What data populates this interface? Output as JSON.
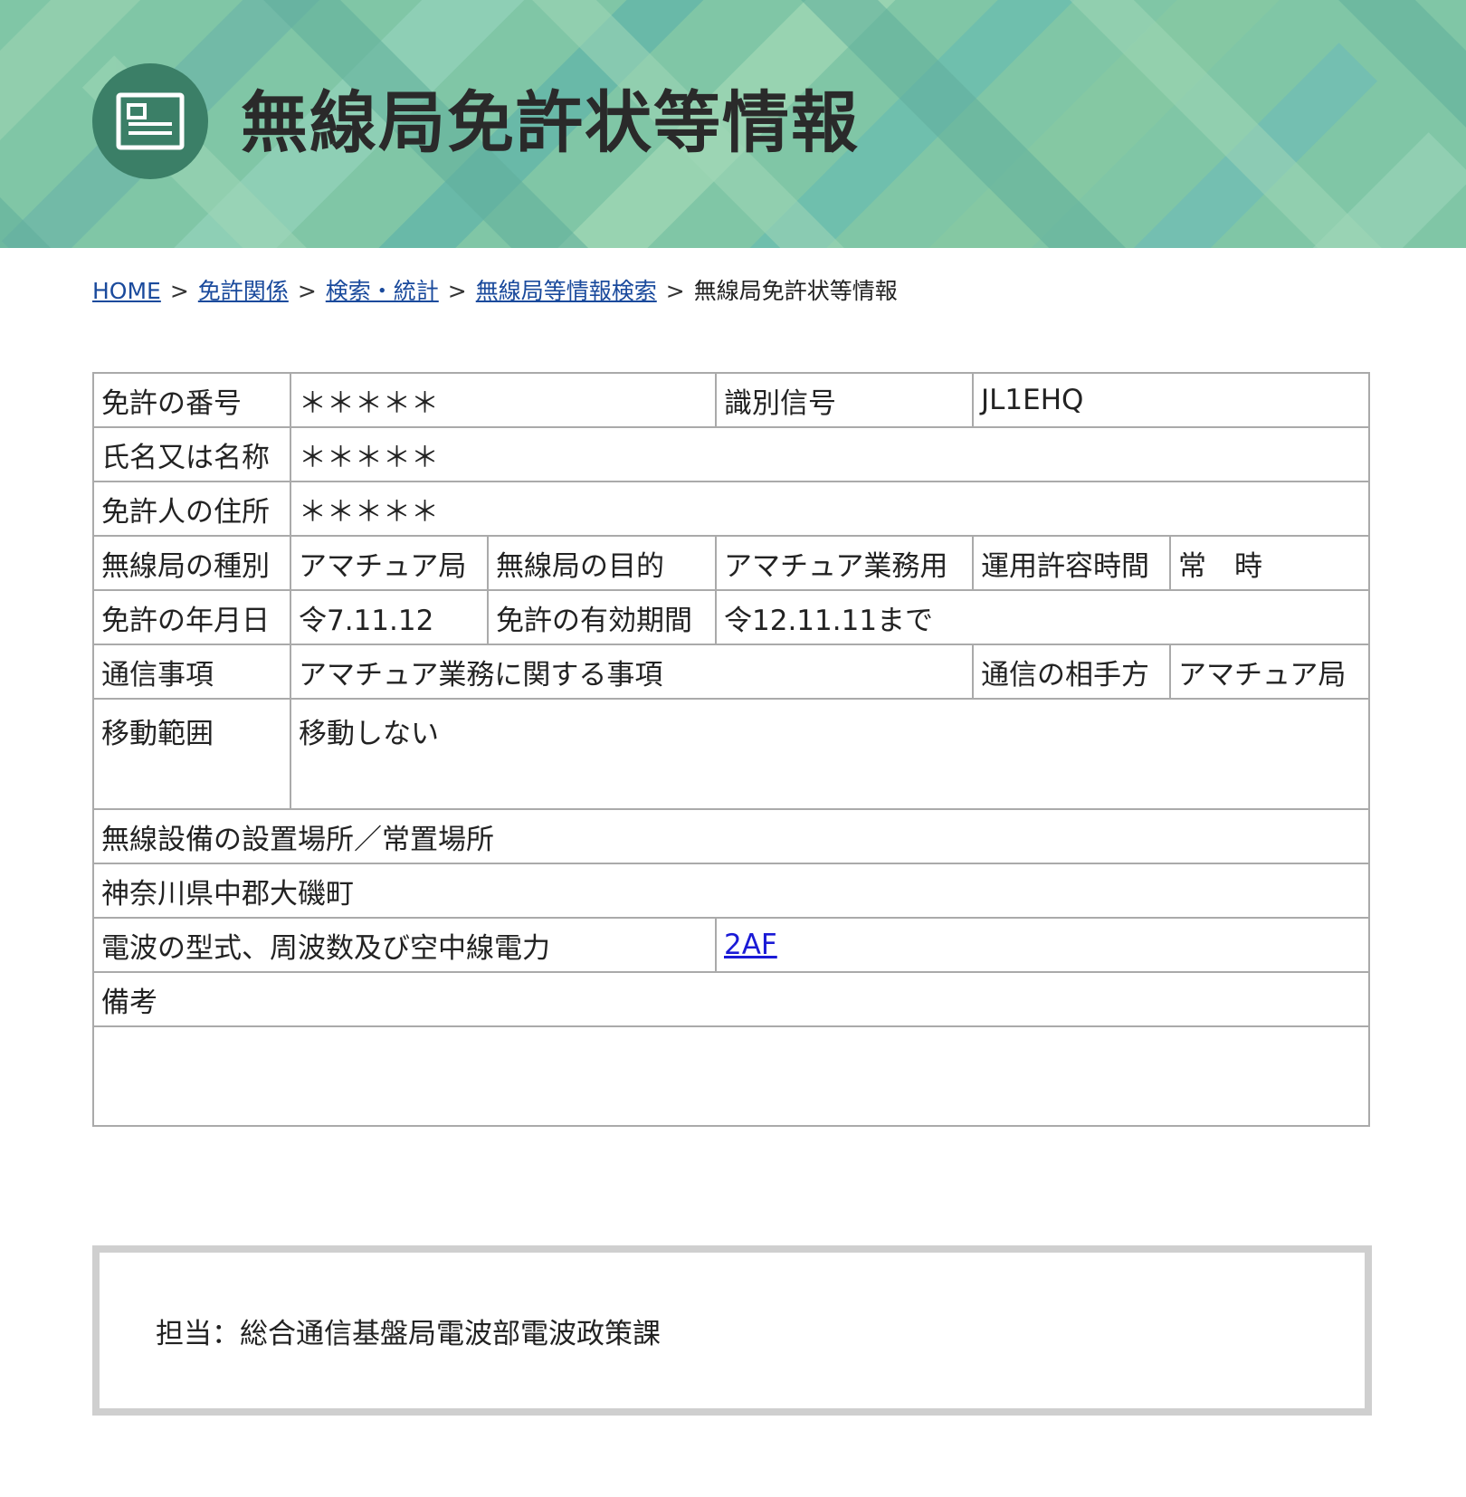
{
  "header": {
    "title": "無線局免許状等情報",
    "icon": "license-card-icon",
    "colors": {
      "banner": "#7cc4a6",
      "badge": "#3b7f67"
    }
  },
  "breadcrumb": {
    "items": [
      {
        "label": "HOME"
      },
      {
        "label": "免許関係"
      },
      {
        "label": "検索・統計"
      },
      {
        "label": "無線局等情報検索"
      }
    ],
    "current": "無線局免許状等情報",
    "separator": ">"
  },
  "license": {
    "license_number_label": "免許の番号",
    "license_number": "＊＊＊＊＊",
    "call_sign_label": "識別信号",
    "call_sign": "JL1EHQ",
    "name_label": "氏名又は名称",
    "name": "＊＊＊＊＊",
    "address_label": "免許人の住所",
    "address": "＊＊＊＊＊",
    "station_type_label": "無線局の種別",
    "station_type": "アマチュア局",
    "purpose_label": "無線局の目的",
    "purpose": "アマチュア業務用",
    "operating_hours_label": "運用許容時間",
    "operating_hours": "常　時",
    "license_date_label": "免許の年月日",
    "license_date": "令7.11.12",
    "validity_label": "免許の有効期間",
    "validity": "令12.11.11まで",
    "comm_matters_label": "通信事項",
    "comm_matters": "アマチュア業務に関する事項",
    "comm_partner_label": "通信の相手方",
    "comm_partner": "アマチュア局",
    "movement_label": "移動範囲",
    "movement": "移動しない",
    "location_label": "無線設備の設置場所／常置場所",
    "location": "神奈川県中郡大磯町",
    "emission_label": "電波の型式、周波数及び空中線電力",
    "emission": "2AF",
    "remarks_label": "備考",
    "remarks": ""
  },
  "footer": {
    "contact": "担当：総合通信基盤局電波部電波政策課"
  }
}
